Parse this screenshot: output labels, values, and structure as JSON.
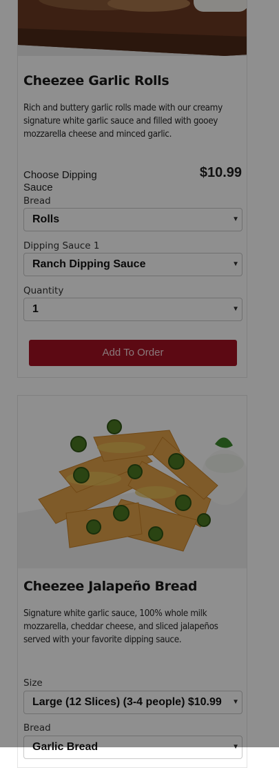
{
  "products": [
    {
      "name": "Cheezee Garlic Rolls",
      "description": "Rich and buttery garlic rolls made with our creamy signature white garlic sauce and filled with gooey mozzarella cheese and minced garlic.",
      "option_caption": "Choose Dipping Sauce",
      "price": "$10.99",
      "fields": [
        {
          "label": "Bread",
          "value": "Rolls"
        },
        {
          "label": "Dipping Sauce 1",
          "value": "Ranch Dipping Sauce"
        },
        {
          "label": "Quantity",
          "value": "1"
        }
      ],
      "add_button": "Add To Order"
    },
    {
      "name": "Cheezee Jalapeño Bread",
      "description": "Signature white garlic sauce, 100% whole milk mozzarella, cheddar cheese, and sliced jalapeños served with your favorite dipping sauce.",
      "fields": [
        {
          "label": "Size",
          "value": "Large (12 Slices) (3-4 people) $10.99"
        },
        {
          "label": "Bread",
          "value": "Garlic Bread"
        }
      ]
    }
  ],
  "colors": {
    "accent": "#a51022",
    "overlay": "rgba(0,0,0,0.44)"
  },
  "icons": {
    "select_arrow": "chevron-down-icon"
  }
}
